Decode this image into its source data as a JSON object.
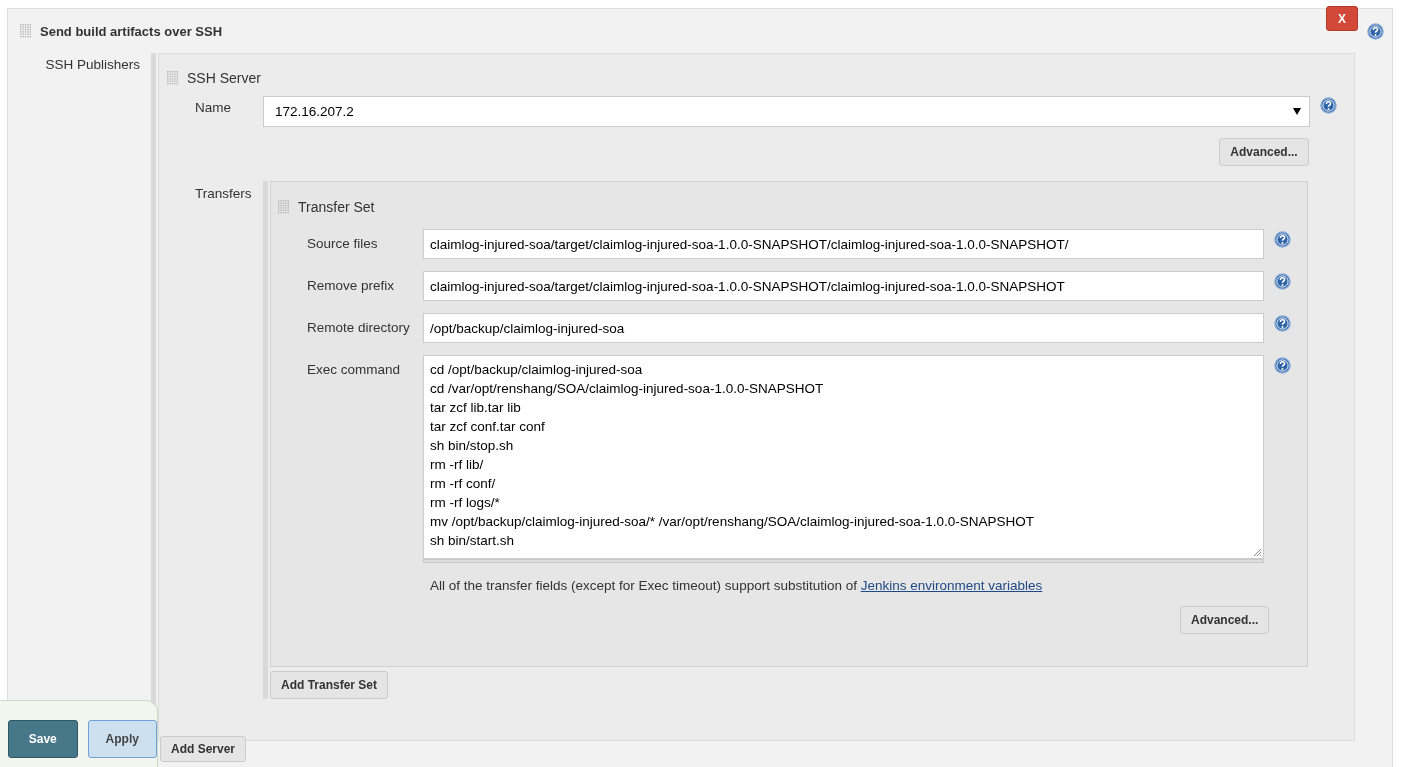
{
  "section": {
    "title": "Send build artifacts over SSH",
    "delete_button": "X"
  },
  "publishers": {
    "label": "SSH Publishers",
    "server": {
      "title": "SSH Server",
      "name_label": "Name",
      "name_value": "172.16.207.2",
      "advanced_button": "Advanced...",
      "transfers_label": "Transfers",
      "transfer_set": {
        "title": "Transfer Set",
        "fields": [
          {
            "kind": "input",
            "label": "Source files",
            "value": "claimlog-injured-soa/target/claimlog-injured-soa-1.0.0-SNAPSHOT/claimlog-injured-soa-1.0.0-SNAPSHOT/"
          },
          {
            "kind": "input",
            "label": "Remove prefix",
            "value": "claimlog-injured-soa/target/claimlog-injured-soa-1.0.0-SNAPSHOT/claimlog-injured-soa-1.0.0-SNAPSHOT"
          },
          {
            "kind": "input",
            "label": "Remote directory",
            "value": "/opt/backup/claimlog-injured-soa"
          },
          {
            "kind": "textarea",
            "label": "Exec command",
            "lines": [
              "cd /opt/backup/claimlog-injured-soa",
              "cd /var/opt/renshang/SOA/claimlog-injured-soa-1.0.0-SNAPSHOT",
              "tar zcf lib.tar lib",
              "tar zcf conf.tar conf",
              "sh bin/stop.sh",
              "rm -rf lib/",
              "rm -rf conf/",
              "rm -rf logs/*",
              "mv /opt/backup/claimlog-injured-soa/* /var/opt/renshang/SOA/claimlog-injured-soa-1.0.0-SNAPSHOT",
              "sh bin/start.sh"
            ]
          }
        ],
        "note": "All of the transfer fields (except for Exec timeout) support substitution of ",
        "note_link": "Jenkins environment variables",
        "advanced_button": "Advanced..."
      },
      "add_transfer_set_button": "Add Transfer Set"
    },
    "add_server_button": "Add Server"
  },
  "actions": [
    {
      "kind": "primary",
      "label": "Save"
    },
    {
      "kind": "secondary",
      "label": "Apply"
    }
  ]
}
